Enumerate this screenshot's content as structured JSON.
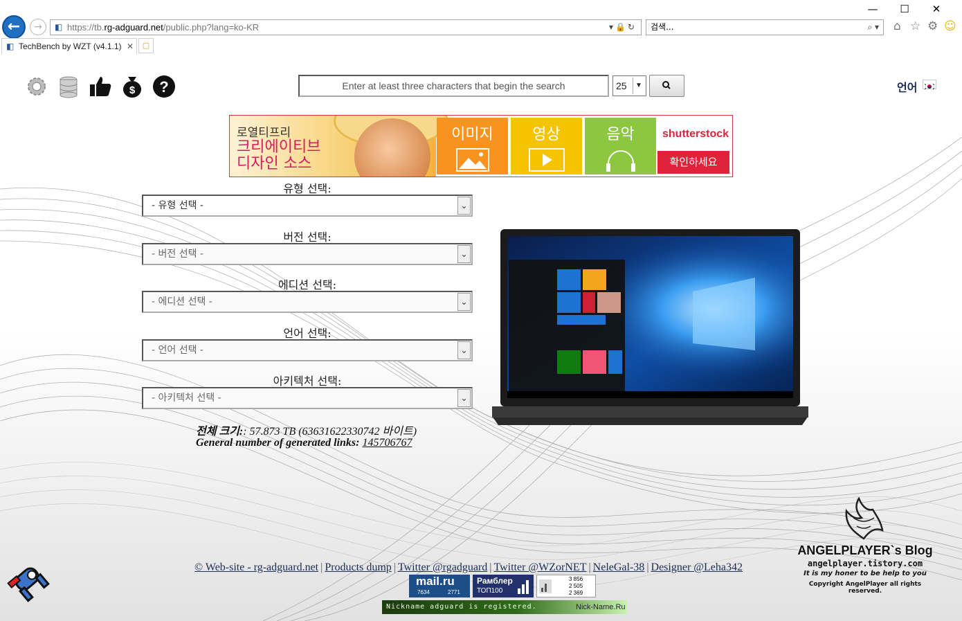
{
  "browser": {
    "url_prefix": "https://tb.",
    "url_domain": "rg-adguard.net",
    "url_path": "/public.php?lang=ko-KR",
    "search_placeholder": "검색...",
    "tab_title": "TechBench by WZT (v4.1.1)"
  },
  "top": {
    "search_placeholder": "Enter at least three characters that begin the search",
    "results_count": "25",
    "language_label": "언어"
  },
  "banner": {
    "tagline1": "로열티프리",
    "tagline2": "크리에이티브",
    "tagline3": "디자인 소스",
    "tiles": [
      {
        "label": "이미지",
        "color": "#f7931e"
      },
      {
        "label": "영상",
        "color": "#f5c400"
      },
      {
        "label": "음악",
        "color": "#8dc63f"
      }
    ],
    "brand": "shutterstock",
    "cta": "확인하세요"
  },
  "form": {
    "type": {
      "label": "유형 선택:",
      "value": "- 유형 선택 -"
    },
    "version": {
      "label": "버전 선택:",
      "value": "- 버전 선택 -"
    },
    "edition": {
      "label": "에디션 선택:",
      "value": "- 에디션 선택 -"
    },
    "language": {
      "label": "언어 선택:",
      "value": "- 언어 선택 -"
    },
    "arch": {
      "label": "아키텍처 선택:",
      "value": "- 아키텍처 선택 -"
    }
  },
  "stats": {
    "size_label": "전체 크기:",
    "size_value": ": 57.873 TB (63631622330742 바이트)",
    "links_label": "General number of generated links:",
    "links_value": "145706767"
  },
  "footer": {
    "links": [
      "© Web-site - rg-adguard.net",
      "Products dump",
      "Twitter @rgadguard",
      "Twitter @WZorNET",
      "NeleGal-38",
      "Designer @Leha342"
    ],
    "mail_title": "mail.ru",
    "mail_num1": "7634",
    "mail_num2": "2771",
    "rambler_title": "Рамблер",
    "rambler_sub": "ТОП100",
    "li_values": [
      "3 856",
      "2 505",
      "2 369"
    ],
    "nick_left": "Nickname adguard is registered.",
    "nick_right": "Nick-Name.Ru"
  },
  "blog": {
    "title": "ANGELPLAYER`s Blog",
    "url": "angelplayer.tistory.com",
    "motto": "It is my honer to be help to you",
    "copyright": "Copyright AngelPlayer all rights reserved."
  },
  "colors": {
    "accent": "#1f6fc3",
    "label": "#1b2d55",
    "shutterstock": "#e0233b"
  }
}
